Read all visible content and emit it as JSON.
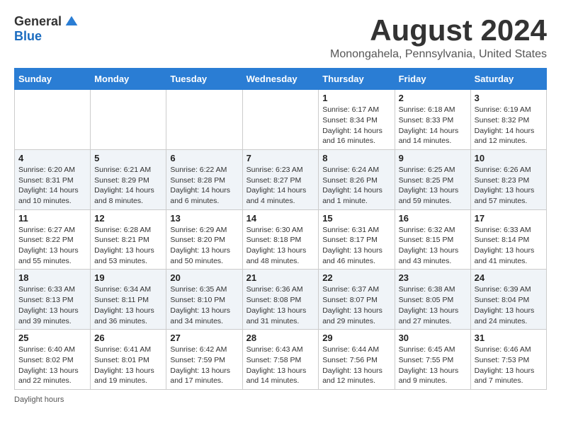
{
  "logo": {
    "general": "General",
    "blue": "Blue"
  },
  "title": {
    "month_year": "August 2024",
    "location": "Monongahela, Pennsylvania, United States"
  },
  "days_of_week": [
    "Sunday",
    "Monday",
    "Tuesday",
    "Wednesday",
    "Thursday",
    "Friday",
    "Saturday"
  ],
  "weeks": [
    [
      {
        "day": "",
        "info": ""
      },
      {
        "day": "",
        "info": ""
      },
      {
        "day": "",
        "info": ""
      },
      {
        "day": "",
        "info": ""
      },
      {
        "day": "1",
        "info": "Sunrise: 6:17 AM\nSunset: 8:34 PM\nDaylight: 14 hours\nand 16 minutes."
      },
      {
        "day": "2",
        "info": "Sunrise: 6:18 AM\nSunset: 8:33 PM\nDaylight: 14 hours\nand 14 minutes."
      },
      {
        "day": "3",
        "info": "Sunrise: 6:19 AM\nSunset: 8:32 PM\nDaylight: 14 hours\nand 12 minutes."
      }
    ],
    [
      {
        "day": "4",
        "info": "Sunrise: 6:20 AM\nSunset: 8:31 PM\nDaylight: 14 hours\nand 10 minutes."
      },
      {
        "day": "5",
        "info": "Sunrise: 6:21 AM\nSunset: 8:29 PM\nDaylight: 14 hours\nand 8 minutes."
      },
      {
        "day": "6",
        "info": "Sunrise: 6:22 AM\nSunset: 8:28 PM\nDaylight: 14 hours\nand 6 minutes."
      },
      {
        "day": "7",
        "info": "Sunrise: 6:23 AM\nSunset: 8:27 PM\nDaylight: 14 hours\nand 4 minutes."
      },
      {
        "day": "8",
        "info": "Sunrise: 6:24 AM\nSunset: 8:26 PM\nDaylight: 14 hours\nand 1 minute."
      },
      {
        "day": "9",
        "info": "Sunrise: 6:25 AM\nSunset: 8:25 PM\nDaylight: 13 hours\nand 59 minutes."
      },
      {
        "day": "10",
        "info": "Sunrise: 6:26 AM\nSunset: 8:23 PM\nDaylight: 13 hours\nand 57 minutes."
      }
    ],
    [
      {
        "day": "11",
        "info": "Sunrise: 6:27 AM\nSunset: 8:22 PM\nDaylight: 13 hours\nand 55 minutes."
      },
      {
        "day": "12",
        "info": "Sunrise: 6:28 AM\nSunset: 8:21 PM\nDaylight: 13 hours\nand 53 minutes."
      },
      {
        "day": "13",
        "info": "Sunrise: 6:29 AM\nSunset: 8:20 PM\nDaylight: 13 hours\nand 50 minutes."
      },
      {
        "day": "14",
        "info": "Sunrise: 6:30 AM\nSunset: 8:18 PM\nDaylight: 13 hours\nand 48 minutes."
      },
      {
        "day": "15",
        "info": "Sunrise: 6:31 AM\nSunset: 8:17 PM\nDaylight: 13 hours\nand 46 minutes."
      },
      {
        "day": "16",
        "info": "Sunrise: 6:32 AM\nSunset: 8:15 PM\nDaylight: 13 hours\nand 43 minutes."
      },
      {
        "day": "17",
        "info": "Sunrise: 6:33 AM\nSunset: 8:14 PM\nDaylight: 13 hours\nand 41 minutes."
      }
    ],
    [
      {
        "day": "18",
        "info": "Sunrise: 6:33 AM\nSunset: 8:13 PM\nDaylight: 13 hours\nand 39 minutes."
      },
      {
        "day": "19",
        "info": "Sunrise: 6:34 AM\nSunset: 8:11 PM\nDaylight: 13 hours\nand 36 minutes."
      },
      {
        "day": "20",
        "info": "Sunrise: 6:35 AM\nSunset: 8:10 PM\nDaylight: 13 hours\nand 34 minutes."
      },
      {
        "day": "21",
        "info": "Sunrise: 6:36 AM\nSunset: 8:08 PM\nDaylight: 13 hours\nand 31 minutes."
      },
      {
        "day": "22",
        "info": "Sunrise: 6:37 AM\nSunset: 8:07 PM\nDaylight: 13 hours\nand 29 minutes."
      },
      {
        "day": "23",
        "info": "Sunrise: 6:38 AM\nSunset: 8:05 PM\nDaylight: 13 hours\nand 27 minutes."
      },
      {
        "day": "24",
        "info": "Sunrise: 6:39 AM\nSunset: 8:04 PM\nDaylight: 13 hours\nand 24 minutes."
      }
    ],
    [
      {
        "day": "25",
        "info": "Sunrise: 6:40 AM\nSunset: 8:02 PM\nDaylight: 13 hours\nand 22 minutes."
      },
      {
        "day": "26",
        "info": "Sunrise: 6:41 AM\nSunset: 8:01 PM\nDaylight: 13 hours\nand 19 minutes."
      },
      {
        "day": "27",
        "info": "Sunrise: 6:42 AM\nSunset: 7:59 PM\nDaylight: 13 hours\nand 17 minutes."
      },
      {
        "day": "28",
        "info": "Sunrise: 6:43 AM\nSunset: 7:58 PM\nDaylight: 13 hours\nand 14 minutes."
      },
      {
        "day": "29",
        "info": "Sunrise: 6:44 AM\nSunset: 7:56 PM\nDaylight: 13 hours\nand 12 minutes."
      },
      {
        "day": "30",
        "info": "Sunrise: 6:45 AM\nSunset: 7:55 PM\nDaylight: 13 hours\nand 9 minutes."
      },
      {
        "day": "31",
        "info": "Sunrise: 6:46 AM\nSunset: 7:53 PM\nDaylight: 13 hours\nand 7 minutes."
      }
    ]
  ],
  "footer": {
    "note": "Daylight hours"
  }
}
